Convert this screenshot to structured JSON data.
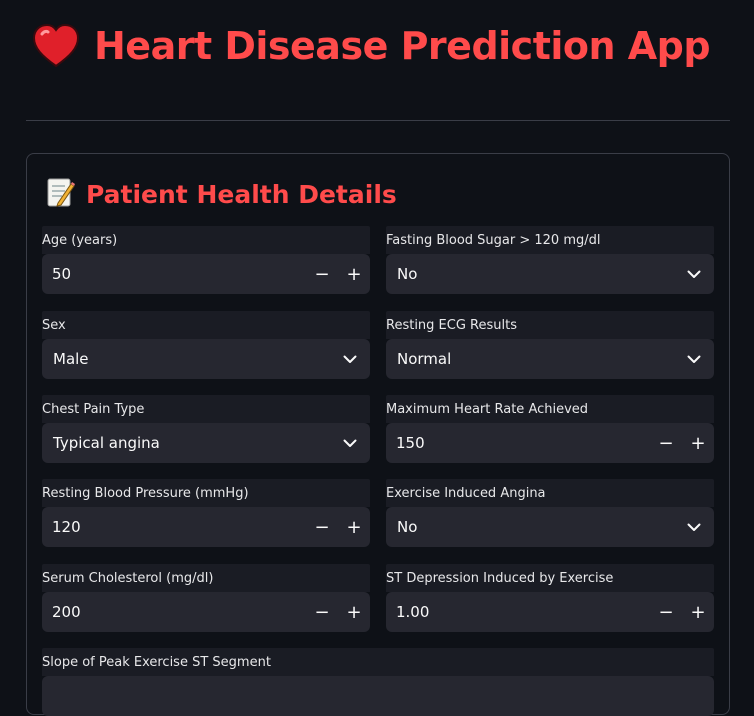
{
  "app": {
    "title": "Heart Disease Prediction App"
  },
  "form": {
    "title": "Patient Health Details",
    "fields": {
      "age": {
        "label": "Age (years)",
        "value": "50"
      },
      "sex": {
        "label": "Sex",
        "value": "Male"
      },
      "chest_pain": {
        "label": "Chest Pain Type",
        "value": "Typical angina"
      },
      "resting_bp": {
        "label": "Resting Blood Pressure (mmHg)",
        "value": "120"
      },
      "cholesterol": {
        "label": "Serum Cholesterol (mg/dl)",
        "value": "200"
      },
      "fasting_bs": {
        "label": "Fasting Blood Sugar > 120 mg/dl",
        "value": "No"
      },
      "resting_ecg": {
        "label": "Resting ECG Results",
        "value": "Normal"
      },
      "max_hr": {
        "label": "Maximum Heart Rate Achieved",
        "value": "150"
      },
      "exercise_angina": {
        "label": "Exercise Induced Angina",
        "value": "No"
      },
      "st_depression": {
        "label": "ST Depression Induced by Exercise",
        "value": "1.00"
      },
      "slope": {
        "label": "Slope of Peak Exercise ST Segment"
      }
    }
  },
  "icons": {
    "title_icon": "heart-icon",
    "form_icon": "memo-icon",
    "minus": "−",
    "plus": "+"
  },
  "colors": {
    "background": "#0e1117",
    "accent": "#ff4b4b",
    "input_bg": "#262730"
  }
}
